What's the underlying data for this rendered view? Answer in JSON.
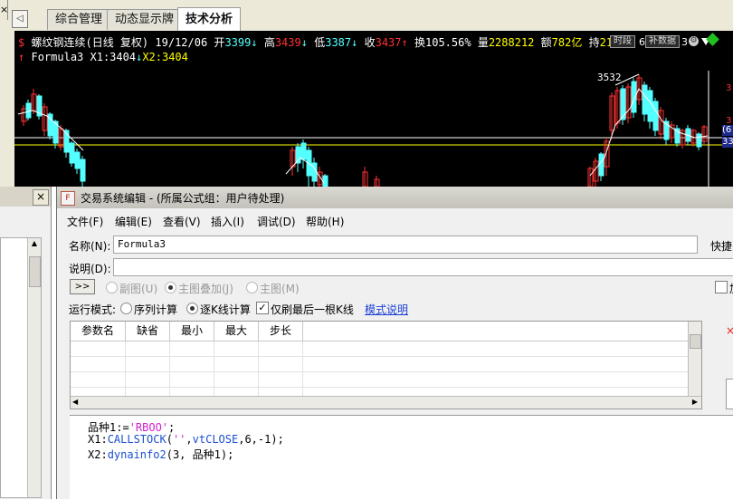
{
  "tabs": [
    {
      "label": "综合管理",
      "active": false
    },
    {
      "label": "动态显示牌",
      "active": false
    },
    {
      "label": "技术分析",
      "active": true
    }
  ],
  "chart": {
    "info_line1": {
      "name": "螺纹钢连续(日线 复权)",
      "date": "19/12/06",
      "open_label": "开",
      "open_value": "3399",
      "high_label": "高",
      "high_value": "3439",
      "low_label": "低",
      "low_value": "3387",
      "close_label": "收",
      "close_value": "3437",
      "turnover_label": "换",
      "turnover_value": "105.56%",
      "volume_label": "量",
      "volume_value": "2288212",
      "amount_label": "额",
      "amount_value": "782亿",
      "position_label": "持",
      "position_value": "21",
      "btn_timeframe": "时段",
      "btn_supplement": "补数据",
      "tail": "6",
      "tail2": "3"
    },
    "info_line2": {
      "formula": "Formula3",
      "x1": "X1:3404",
      "x2": "X2:3404"
    },
    "peak_label": "3532",
    "right_axis": [
      "3",
      "3",
      "(6",
      "33"
    ],
    "colors": {
      "up": "#ff3232",
      "down": "#54ffff",
      "bg": "#000000",
      "text": "#ffffff",
      "yellow": "#ffff00"
    }
  },
  "dialog": {
    "title": "交易系统编辑 - (所属公式组：用户待处理)",
    "menu": [
      "文件(F)",
      "编辑(E)",
      "查看(V)",
      "插入(I)",
      "调试(D)",
      "帮助(H)"
    ],
    "name_label": "名称(N):",
    "name_value": "Formula3",
    "shortcut_label": "快捷",
    "desc_label": "说明(D):",
    "desc_value": "",
    "expand_btn": ">>",
    "chart_modes": [
      {
        "label": "副图(U)",
        "selected": false
      },
      {
        "label": "主图叠加(J)",
        "selected": true
      },
      {
        "label": "主图(M)",
        "selected": false
      }
    ],
    "right_checkbox_label": "加",
    "run_mode_label": "运行模式:",
    "run_modes": [
      {
        "label": "序列计算",
        "selected": false
      },
      {
        "label": "逐K线计算",
        "selected": true
      }
    ],
    "refresh_last_label": "仅刷最后一根K线",
    "refresh_last_checked": true,
    "mode_help_link": "模式说明",
    "param_headers": [
      "参数名",
      "缺省",
      "最小",
      "最大",
      "步长"
    ],
    "code": {
      "line1_var": "品种1:=",
      "line1_str": "'RBOO'",
      "line1_end": ";",
      "line2_a": "X1:",
      "line2_fn": "CALLSTOCK",
      "line2_b": "(",
      "line2_str": "''",
      "line2_c": ",",
      "line2_const": "vtCLOSE",
      "line2_d": ",6,-1);",
      "line3_a": "X2:",
      "line3_fn": "dynainfo2",
      "line3_b": "(3, 品种1);"
    }
  },
  "left_panel": {
    "close_label": "×"
  },
  "scroll_btn": "◁"
}
